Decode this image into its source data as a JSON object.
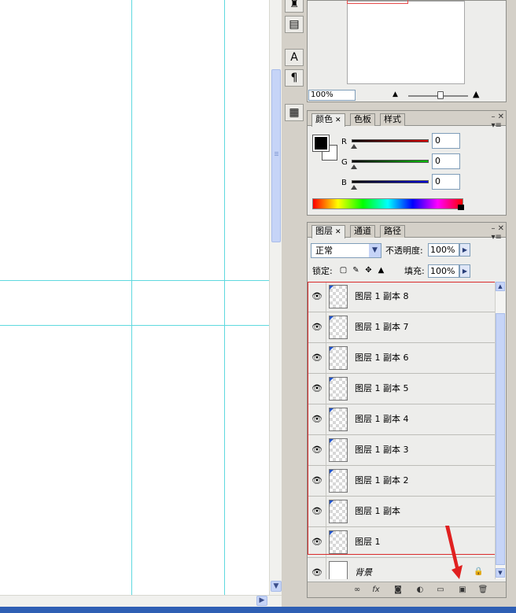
{
  "navigator": {
    "zoom": "100%"
  },
  "color": {
    "tabs": [
      "颜色",
      "色板",
      "样式"
    ],
    "channels": [
      {
        "label": "R",
        "value": "0",
        "color": "#cc0000"
      },
      {
        "label": "G",
        "value": "0",
        "color": "#00aa00"
      },
      {
        "label": "B",
        "value": "0",
        "color": "#0000cc"
      }
    ],
    "foreground": "#000000",
    "background": "#ffffff"
  },
  "layers": {
    "tabs": [
      "图层",
      "通道",
      "路径"
    ],
    "blend_mode": "正常",
    "opacity_label": "不透明度:",
    "opacity": "100%",
    "lock_label": "锁定:",
    "fill_label": "填充:",
    "fill": "100%",
    "items": [
      {
        "name": "图层 1 副本 8"
      },
      {
        "name": "图层 1 副本 7"
      },
      {
        "name": "图层 1 副本 6"
      },
      {
        "name": "图层 1 副本 5"
      },
      {
        "name": "图层 1 副本 4"
      },
      {
        "name": "图层 1 副本 3"
      },
      {
        "name": "图层 1 副本 2"
      },
      {
        "name": "图层 1 副本"
      },
      {
        "name": "图层 1"
      },
      {
        "name": "背景"
      }
    ],
    "footer_fx": "fx"
  },
  "accent": {
    "guide": "#5fd9df",
    "selection": "#d92b2b",
    "scroll": "#c6d4f7"
  }
}
